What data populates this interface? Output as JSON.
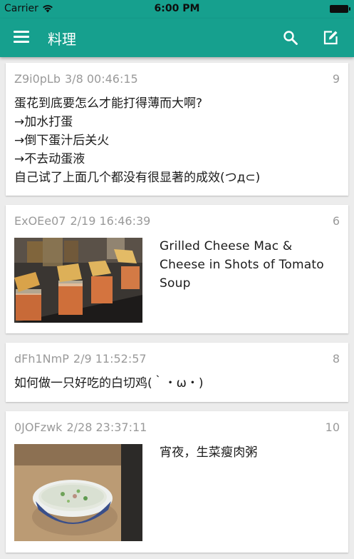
{
  "status_bar": {
    "carrier": "Carrier",
    "time": "6:00 PM"
  },
  "app_bar": {
    "title": "料理"
  },
  "posts": [
    {
      "id": "Z9i0pLb",
      "date": "3/8 00:46:15",
      "count": "9",
      "lines": [
        "蛋花到底要怎么才能打得薄而大啊?",
        "→加水打蛋",
        "→倒下蛋汁后关火",
        "→不去动蛋液",
        "自己试了上面几个都没有很显著的成效(つд⊂)"
      ]
    },
    {
      "id": "ExOEe07",
      "date": "2/19 16:46:39",
      "count": "6",
      "text": "Grilled Cheese Mac & Cheese in Shots of Tomato Soup"
    },
    {
      "id": "dFh1NmP",
      "date": "2/9 11:52:57",
      "count": "8",
      "text": "如何做一只好吃的白切鸡(｀・ω・)"
    },
    {
      "id": "0JOFzwk",
      "date": "2/28 23:37:11",
      "count": "10",
      "text": "宵夜，生菜瘦肉粥"
    }
  ],
  "icons": {
    "menu": "menu-icon",
    "search": "search-icon",
    "compose": "compose-icon",
    "wifi": "wifi-icon",
    "battery": "battery-icon"
  },
  "colors": {
    "accent": "#16a08e",
    "background": "#ececec",
    "meta_text": "#9a9a9a"
  }
}
